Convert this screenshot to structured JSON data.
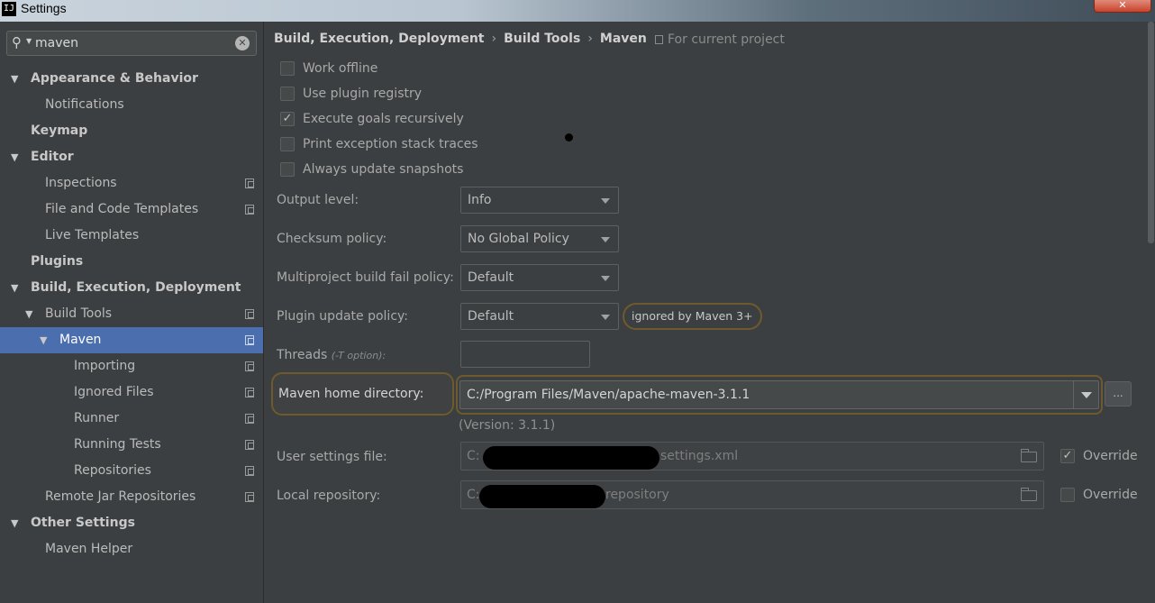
{
  "window": {
    "title": "Settings",
    "app_icon": "IJ"
  },
  "search": {
    "value": "maven"
  },
  "sidebar": {
    "items": [
      {
        "label": "Appearance & Behavior",
        "level": 0,
        "bold": true,
        "arrow": "▼",
        "copy": false,
        "selected": false
      },
      {
        "label": "Notifications",
        "level": 1,
        "bold": false,
        "arrow": "",
        "copy": false,
        "selected": false
      },
      {
        "label": "Keymap",
        "level": 0,
        "bold": true,
        "arrow": "",
        "copy": false,
        "selected": false
      },
      {
        "label": "Editor",
        "level": 0,
        "bold": true,
        "arrow": "▼",
        "copy": false,
        "selected": false
      },
      {
        "label": "Inspections",
        "level": 1,
        "bold": false,
        "arrow": "",
        "copy": true,
        "selected": false
      },
      {
        "label": "File and Code Templates",
        "level": 1,
        "bold": false,
        "arrow": "",
        "copy": true,
        "selected": false
      },
      {
        "label": "Live Templates",
        "level": 1,
        "bold": false,
        "arrow": "",
        "copy": false,
        "selected": false
      },
      {
        "label": "Plugins",
        "level": 0,
        "bold": true,
        "arrow": "",
        "copy": false,
        "selected": false
      },
      {
        "label": "Build, Execution, Deployment",
        "level": 0,
        "bold": true,
        "arrow": "▼",
        "copy": false,
        "selected": false
      },
      {
        "label": "Build Tools",
        "level": 1,
        "bold": false,
        "arrow": "▼",
        "copy": true,
        "selected": false
      },
      {
        "label": "Maven",
        "level": 2,
        "bold": false,
        "arrow": "▼",
        "copy": true,
        "selected": true
      },
      {
        "label": "Importing",
        "level": 3,
        "bold": false,
        "arrow": "",
        "copy": true,
        "selected": false
      },
      {
        "label": "Ignored Files",
        "level": 3,
        "bold": false,
        "arrow": "",
        "copy": true,
        "selected": false
      },
      {
        "label": "Runner",
        "level": 3,
        "bold": false,
        "arrow": "",
        "copy": true,
        "selected": false
      },
      {
        "label": "Running Tests",
        "level": 3,
        "bold": false,
        "arrow": "",
        "copy": true,
        "selected": false
      },
      {
        "label": "Repositories",
        "level": 3,
        "bold": false,
        "arrow": "",
        "copy": true,
        "selected": false
      },
      {
        "label": "Remote Jar Repositories",
        "level": 1,
        "bold": false,
        "arrow": "",
        "copy": true,
        "selected": false
      },
      {
        "label": "Other Settings",
        "level": 0,
        "bold": true,
        "arrow": "▼",
        "copy": false,
        "selected": false
      },
      {
        "label": "Maven Helper",
        "level": 1,
        "bold": false,
        "arrow": "",
        "copy": false,
        "selected": false
      }
    ]
  },
  "breadcrumb": [
    "Build, Execution, Deployment",
    "Build Tools",
    "Maven"
  ],
  "for_current_project": "For current project",
  "checkboxes": [
    {
      "label": "Work offline",
      "checked": false
    },
    {
      "label": "Use plugin registry",
      "checked": false
    },
    {
      "label": "Execute goals recursively",
      "checked": true
    },
    {
      "label": "Print exception stack traces",
      "checked": false
    },
    {
      "label": "Always update snapshots",
      "checked": false
    }
  ],
  "fields": {
    "output_level": {
      "label": "Output level:",
      "value": "Info"
    },
    "checksum_policy": {
      "label": "Checksum policy:",
      "value": "No Global Policy"
    },
    "multiproject_fail": {
      "label": "Multiproject build fail policy:",
      "value": "Default"
    },
    "plugin_update": {
      "label": "Plugin update policy:",
      "value": "Default",
      "badge": "ignored by Maven 3+"
    },
    "threads": {
      "label": "Threads",
      "hint": "(-T option):",
      "value": ""
    },
    "maven_home": {
      "label": "Maven home directory:",
      "value": "C:/Program Files/Maven/apache-maven-3.1.1",
      "browse": "..."
    },
    "version": "(Version: 3.1.1)",
    "user_settings": {
      "label": "User settings file:",
      "prefix": "C:",
      "suffix": "settings.xml",
      "override_label": "Override",
      "override": true
    },
    "local_repo": {
      "label": "Local repository:",
      "prefix": "C:",
      "suffix": "repository",
      "override_label": "Override",
      "override": false
    }
  },
  "colors": {
    "background": "#3c3f41",
    "selection": "#4b6eaf",
    "highlight_border": "#6e5a2c"
  }
}
